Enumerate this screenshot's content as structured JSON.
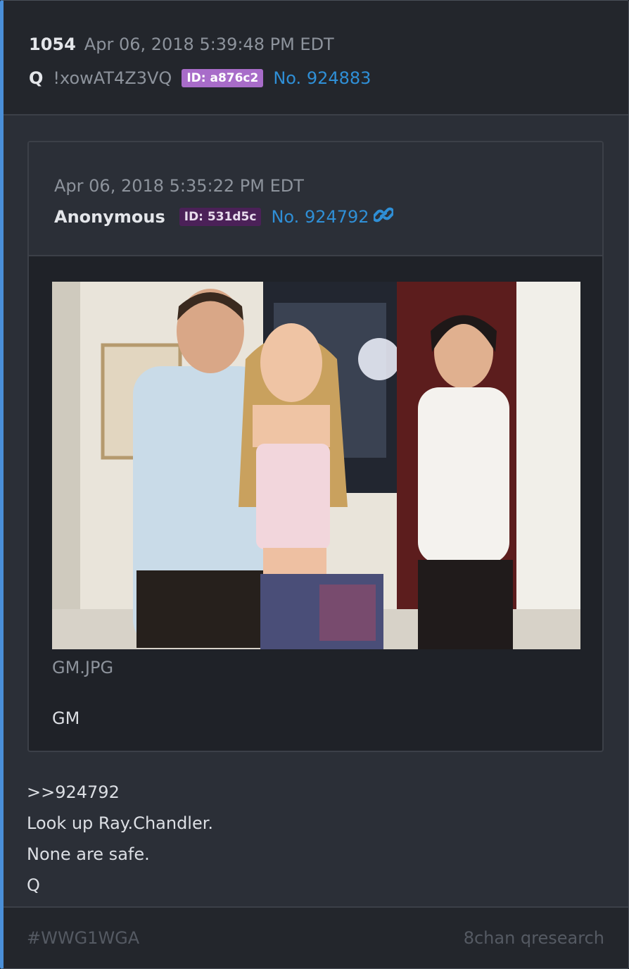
{
  "post": {
    "number": "1054",
    "date": "Apr 06, 2018 5:39:48 PM EDT",
    "author": "Q",
    "tripcode": "!xowAT4Z3VQ",
    "id_badge": "ID: a876c2",
    "post_link": "No. 924883"
  },
  "quoted": {
    "date": "Apr 06, 2018 5:35:22 PM EDT",
    "author": "Anonymous",
    "id_badge": "ID: 531d5c",
    "post_link": "No. 924792",
    "filename": "GM.JPG",
    "text": "GM"
  },
  "body": {
    "lines": [
      ">>924792",
      "Look up Ray.Chandler.",
      "None are safe.",
      "Q"
    ]
  },
  "footer": {
    "hashtag": "#WWG1WGA",
    "source": "8chan qresearch"
  },
  "colors": {
    "accent": "#4a8fd8",
    "link": "#2f8fd6",
    "id_q": "#a86cc9",
    "id_anon": "#4b2158"
  }
}
